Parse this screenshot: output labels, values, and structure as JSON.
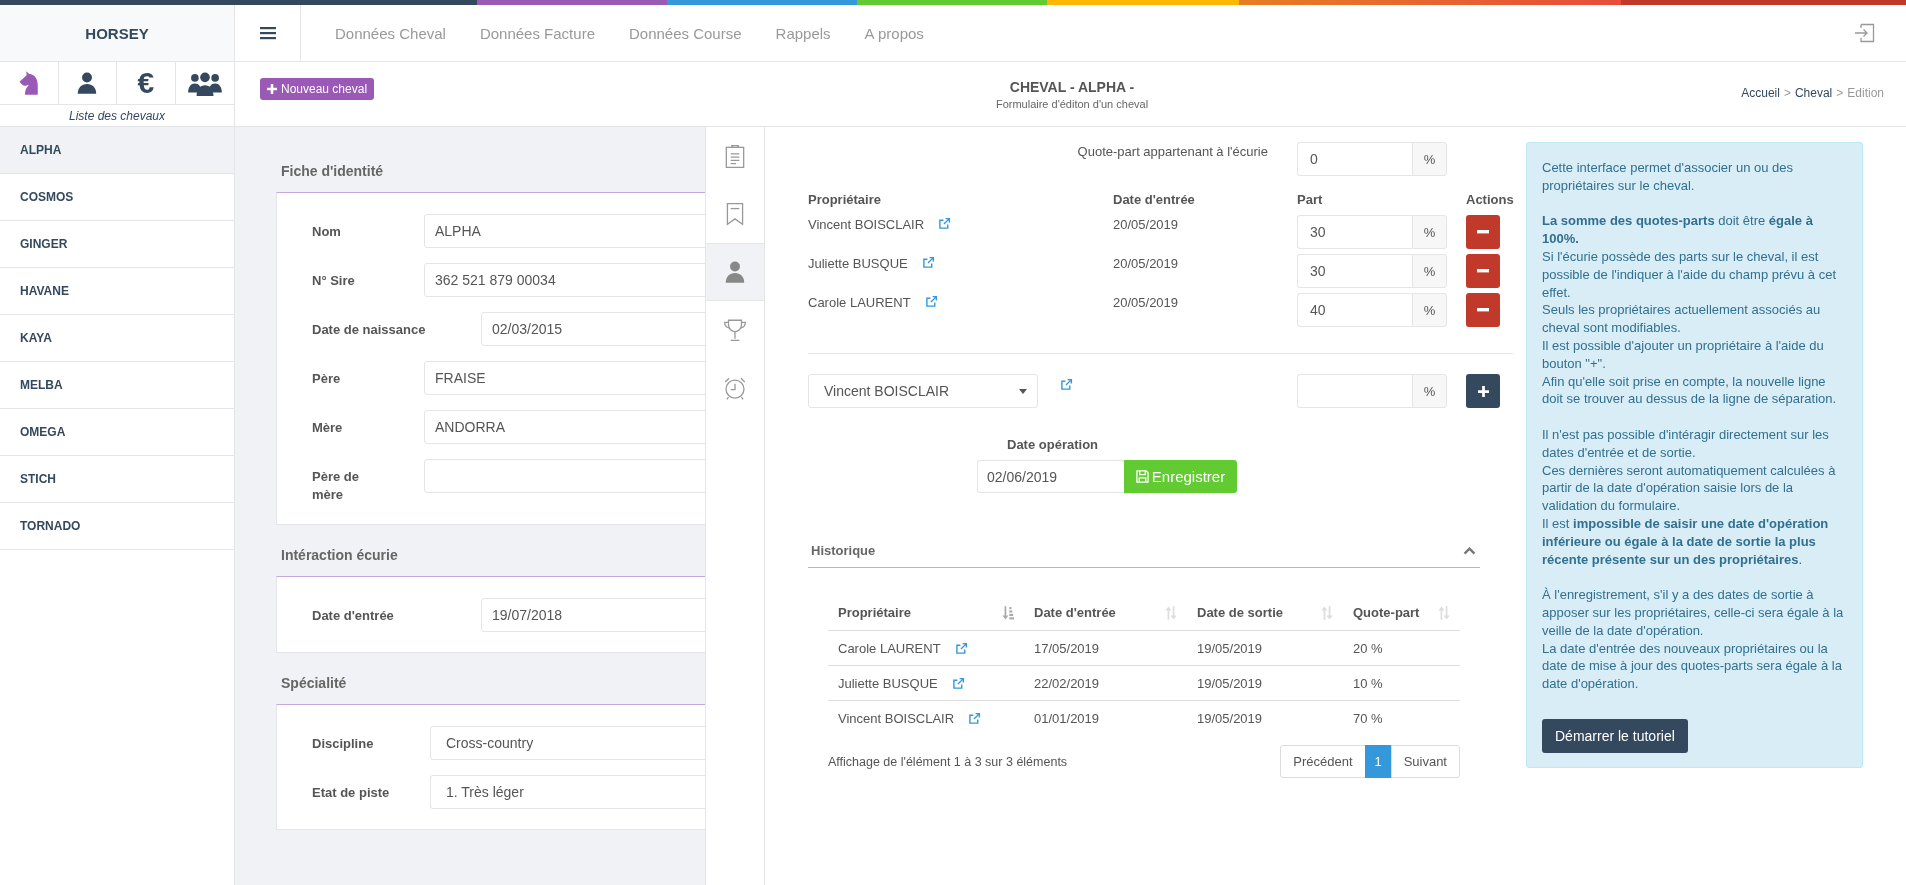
{
  "nav": {
    "brand": "HORSEY",
    "items": [
      "Données Cheval",
      "Données Facture",
      "Données Course",
      "Rappels",
      "A propos"
    ]
  },
  "sidebar": {
    "icon_tabs": [
      {
        "kind": "horse",
        "selected": true
      },
      {
        "kind": "person",
        "selected": false
      },
      {
        "kind": "symbol",
        "label": "€",
        "selected": false
      },
      {
        "kind": "group",
        "selected": false
      }
    ],
    "caption": "Liste des chevaux",
    "horses": [
      {
        "name": "ALPHA",
        "selected": true
      },
      {
        "name": "COSMOS",
        "selected": false
      },
      {
        "name": "GINGER",
        "selected": false
      },
      {
        "name": "HAVANE",
        "selected": false
      },
      {
        "name": "KAYA",
        "selected": false
      },
      {
        "name": "MELBA",
        "selected": false
      },
      {
        "name": "OMEGA",
        "selected": false
      },
      {
        "name": "STICH",
        "selected": false
      },
      {
        "name": "TORNADO",
        "selected": false
      }
    ]
  },
  "page_header": {
    "new_button": "Nouveau cheval",
    "title": "CHEVAL - ALPHA -",
    "subtitle": "Formulaire d'éditon d'un cheval",
    "breadcrumb": {
      "separator": ">",
      "items": [
        {
          "label": "Accueil",
          "current": false
        },
        {
          "label": "Cheval",
          "current": false
        },
        {
          "label": "Edition",
          "current": true
        }
      ]
    }
  },
  "identity_form": {
    "sections": [
      {
        "title": "Fiche d'identité",
        "fields": [
          {
            "label": "Nom",
            "value": "ALPHA",
            "kind": "text"
          },
          {
            "label": "N° Sire",
            "value": "362 521 879 00034",
            "kind": "text"
          },
          {
            "label": "Date de naissance",
            "value": "02/03/2015",
            "kind": "date"
          },
          {
            "label": "Père",
            "value": "FRAISE",
            "kind": "text"
          },
          {
            "label": "Mère",
            "value": "ANDORRA",
            "kind": "text"
          },
          {
            "label": "Père de mère",
            "kind": "text"
          }
        ]
      },
      {
        "title": "Intéraction écurie",
        "fields": [
          {
            "label": "Date d'entrée",
            "value": "19/07/2018",
            "kind": "date"
          }
        ]
      },
      {
        "title": "Spécialité",
        "fields": [
          {
            "label": "Discipline",
            "value": "Cross-country",
            "kind": "select"
          },
          {
            "label": "Etat de piste",
            "value": "1. Très léger",
            "kind": "select"
          }
        ]
      }
    ]
  },
  "side_tabs": [
    {
      "kind": "clipboard",
      "selected": false
    },
    {
      "kind": "bookmark",
      "selected": false
    },
    {
      "kind": "person",
      "selected": true
    },
    {
      "kind": "trophy",
      "selected": false
    },
    {
      "kind": "alarm",
      "selected": false
    }
  ],
  "owners": {
    "stable_share": {
      "label": "Quote-part appartenant à l'écurie",
      "value": "0",
      "unit": "%"
    },
    "columns": [
      "Propriétaire",
      "Date d'entrée",
      "Part",
      "Actions"
    ],
    "rows": [
      {
        "name": "Vincent BOISCLAIR",
        "entry_date": "20/05/2019",
        "part": "30",
        "unit": "%"
      },
      {
        "name": "Juliette BUSQUE",
        "entry_date": "20/05/2019",
        "part": "30",
        "unit": "%"
      },
      {
        "name": "Carole LAURENT",
        "entry_date": "20/05/2019",
        "part": "40",
        "unit": "%"
      }
    ],
    "new_owner": {
      "owner": "Vincent BOISCLAIR",
      "unit": "%"
    },
    "operation": {
      "label": "Date opération",
      "value": "02/06/2019",
      "button": "Enregistrer"
    }
  },
  "history": {
    "title": "Historique",
    "expanded": true,
    "columns": [
      {
        "label": "Propriétaire",
        "sorted": true
      },
      {
        "label": "Date d'entrée",
        "sorted": false
      },
      {
        "label": "Date de sortie",
        "sorted": false
      },
      {
        "label": "Quote-part",
        "sorted": false
      }
    ],
    "rows": [
      {
        "owner": "Carole LAURENT",
        "entry_date": "17/05/2019",
        "exit_date": "19/05/2019",
        "share": "20 %"
      },
      {
        "owner": "Juliette BUSQUE",
        "entry_date": "22/02/2019",
        "exit_date": "19/05/2019",
        "share": "10 %"
      },
      {
        "owner": "Vincent BOISCLAIR",
        "entry_date": "01/01/2019",
        "exit_date": "19/05/2019",
        "share": "70 %"
      }
    ],
    "info": "Affichage de l'élément 1 à 3 sur 3 éléments",
    "pagination": {
      "previous": "Précédent",
      "pages": [
        {
          "label": "1",
          "selected": true
        }
      ],
      "next": "Suivant"
    }
  },
  "help": {
    "groups": [
      [
        "Cette interface permet d'associer un ou des propriétaires sur le cheval."
      ],
      [
        "**La somme des quotes-parts** doit être **égale à 100%.**",
        "Si l'écurie possède des parts sur le cheval, il est possible de l'indiquer à l'aide du champ prévu à cet effet.",
        "Seuls les propriétaires actuellement associés au cheval sont modifiables.",
        "Il est possible d'ajouter un propriétaire à l'aide du bouton \"+\".",
        "Afin qu'elle soit prise en compte, la nouvelle ligne doit se trouver au dessus de la ligne de séparation."
      ],
      [
        "Il n'est pas possible d'intéragir directement sur les dates d'entrée et de sortie.",
        "Ces dernières seront automatiquement calculées à partir de la date d'opération saisie lors de la validation du formulaire.",
        "Il est **impossible de saisir une date d'opération inférieure ou égale à la date de sortie la plus récente présente sur un des propriétaires**."
      ],
      [
        "À l'enregistrement, s'il y a des dates de sortie à apposer sur les propriétaires, celle-ci sera égale à la veille de la date d'opération.",
        "La date d'entrée des nouveaux propriétaires ou la date de mise à jour des quotes-parts sera égale à la date d'opération."
      ]
    ],
    "button": "Démarrer le tutoriel"
  }
}
